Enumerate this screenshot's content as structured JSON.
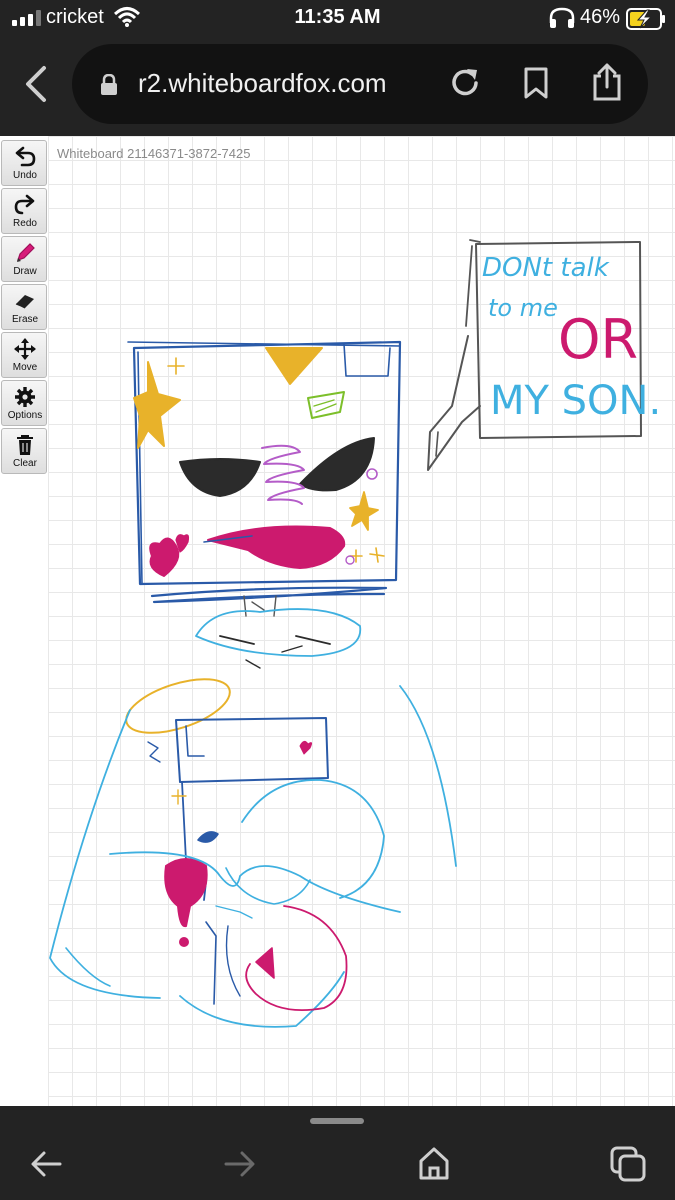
{
  "status": {
    "carrier": "cricket",
    "time": "11:35 AM",
    "battery": "46%"
  },
  "browser": {
    "url": "r2.whiteboardfox.com"
  },
  "whiteboard": {
    "label": "Whiteboard 21146371-3872-7425"
  },
  "toolbar": {
    "tools": [
      {
        "label": "Undo",
        "icon": "undo-icon"
      },
      {
        "label": "Redo",
        "icon": "redo-icon"
      },
      {
        "label": "Draw",
        "icon": "pencil-icon"
      },
      {
        "label": "Erase",
        "icon": "eraser-icon"
      },
      {
        "label": "Move",
        "icon": "move-arrows-icon"
      },
      {
        "label": "Options",
        "icon": "gear-icon"
      },
      {
        "label": "Clear",
        "icon": "trash-icon"
      }
    ],
    "active_tool": "Draw"
  },
  "drawing_text": {
    "line1": "DONt talk",
    "line2": "to me",
    "line3": "OR",
    "line4": "MY SON."
  },
  "colors": {
    "ink_blue": "#2a5aa8",
    "ink_cyan": "#3fb0e0",
    "ink_magenta": "#cc1a6e",
    "ink_yellow": "#e8b22a",
    "ink_black": "#2b2b2b",
    "ink_green": "#7cbf2a",
    "ink_purple": "#b45cc8"
  }
}
